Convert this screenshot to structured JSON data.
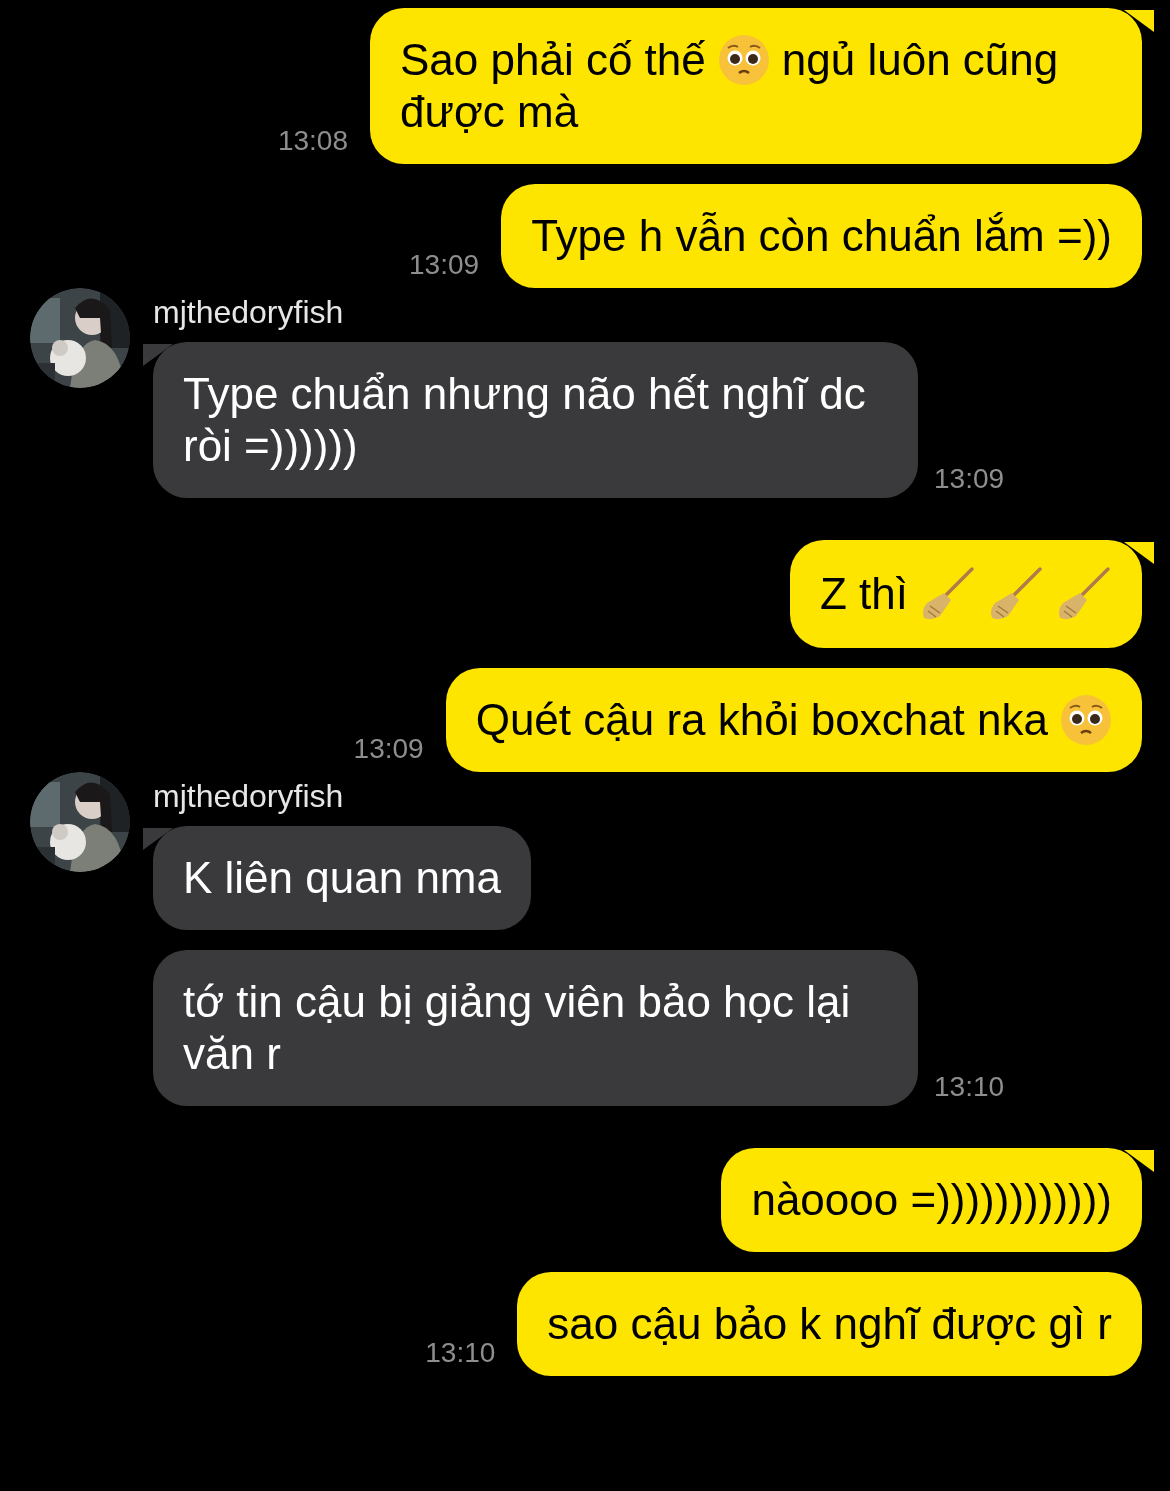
{
  "groups": [
    {
      "kind": "outgoing",
      "messages": [
        {
          "parts": [
            {
              "kind": "text",
              "text": "Sao phải cố thế"
            },
            {
              "kind": "face"
            },
            {
              "kind": "text",
              "text": "ngủ luôn cũng"
            },
            {
              "kind": "text",
              "text": "được mà"
            }
          ],
          "time": "13:08"
        },
        {
          "parts": [
            {
              "kind": "text",
              "text": "Type h vẫn còn chuẩn lắm =))"
            }
          ],
          "time": "13:09"
        }
      ]
    },
    {
      "kind": "incoming",
      "sender": "mjthedoryfish",
      "messages": [
        {
          "parts": [
            {
              "kind": "text",
              "text": "Type chuẩn nhưng não hết nghĩ dc ròi =))))))"
            }
          ],
          "time": "13:09"
        }
      ]
    },
    {
      "kind": "outgoing",
      "messages": [
        {
          "parts": [
            {
              "kind": "text",
              "text": "Z thì"
            },
            {
              "kind": "broom"
            },
            {
              "kind": "broom"
            },
            {
              "kind": "broom"
            }
          ]
        },
        {
          "parts": [
            {
              "kind": "text",
              "text": "Quét cậu ra khỏi boxchat nka"
            },
            {
              "kind": "face"
            }
          ],
          "time": "13:09"
        }
      ]
    },
    {
      "kind": "incoming",
      "sender": "mjthedoryfish",
      "messages": [
        {
          "parts": [
            {
              "kind": "text",
              "text": "K liên quan nma"
            }
          ]
        },
        {
          "parts": [
            {
              "kind": "text",
              "text": "tớ tin cậu bị giảng viên bảo học lại văn r"
            }
          ],
          "time": "13:10"
        }
      ]
    },
    {
      "kind": "outgoing",
      "messages": [
        {
          "parts": [
            {
              "kind": "text",
              "text": "nàoooo =))))))))))))"
            }
          ]
        },
        {
          "parts": [
            {
              "kind": "text",
              "text": "sao cậu bảo k nghĩ được gì r"
            }
          ],
          "time": "13:10"
        }
      ]
    }
  ]
}
